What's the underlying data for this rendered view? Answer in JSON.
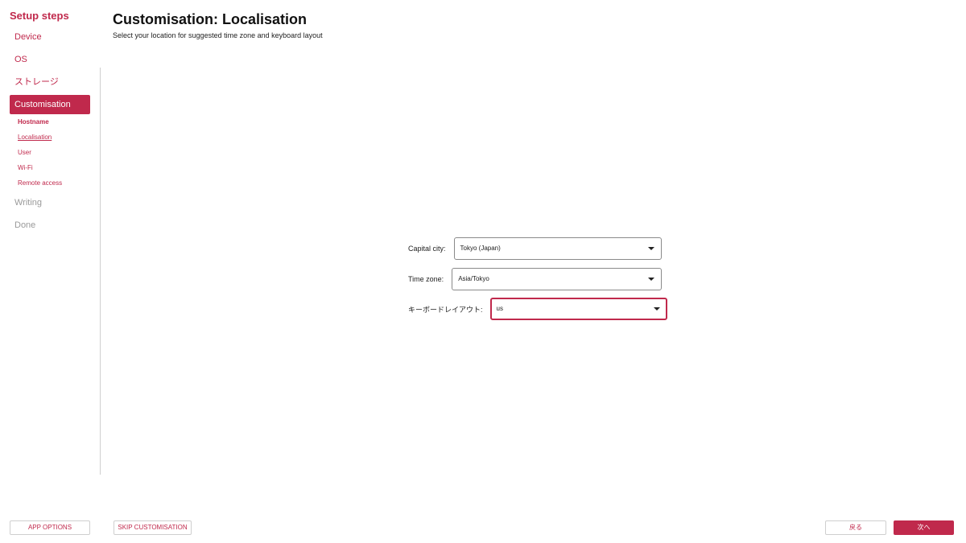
{
  "sidebar": {
    "title": "Setup steps",
    "steps": [
      {
        "label": "Device",
        "state": "link"
      },
      {
        "label": "OS",
        "state": "link"
      },
      {
        "label": "ストレージ",
        "state": "link"
      },
      {
        "label": "Customisation",
        "state": "active"
      },
      {
        "label": "Writing",
        "state": "disabled"
      },
      {
        "label": "Done",
        "state": "disabled"
      }
    ],
    "substeps": [
      {
        "label": "Hostname",
        "style": "bold"
      },
      {
        "label": "Localisation",
        "style": "underline"
      },
      {
        "label": "User",
        "style": "normal"
      },
      {
        "label": "Wi-Fi",
        "style": "normal"
      },
      {
        "label": "Remote access",
        "style": "normal"
      }
    ]
  },
  "main": {
    "title": "Customisation: Localisation",
    "subtitle": "Select your location for suggested time zone and keyboard layout",
    "form": {
      "capital_city": {
        "label": "Capital city:",
        "value": "Tokyo (Japan)"
      },
      "time_zone": {
        "label": "Time zone:",
        "value": "Asia/Tokyo"
      },
      "keyboard_layout": {
        "label": "キーボードレイアウト:",
        "value": "us"
      }
    }
  },
  "footer": {
    "app_options": "APP OPTIONS",
    "skip_customisation": "SKIP CUSTOMISATION",
    "back": "戻る",
    "next": "次へ"
  },
  "colors": {
    "accent": "#c0294c",
    "disabled": "#9a9a9a",
    "divider": "#cfcfcf"
  },
  "icons": {
    "dropdown": "chevron-down-icon"
  }
}
